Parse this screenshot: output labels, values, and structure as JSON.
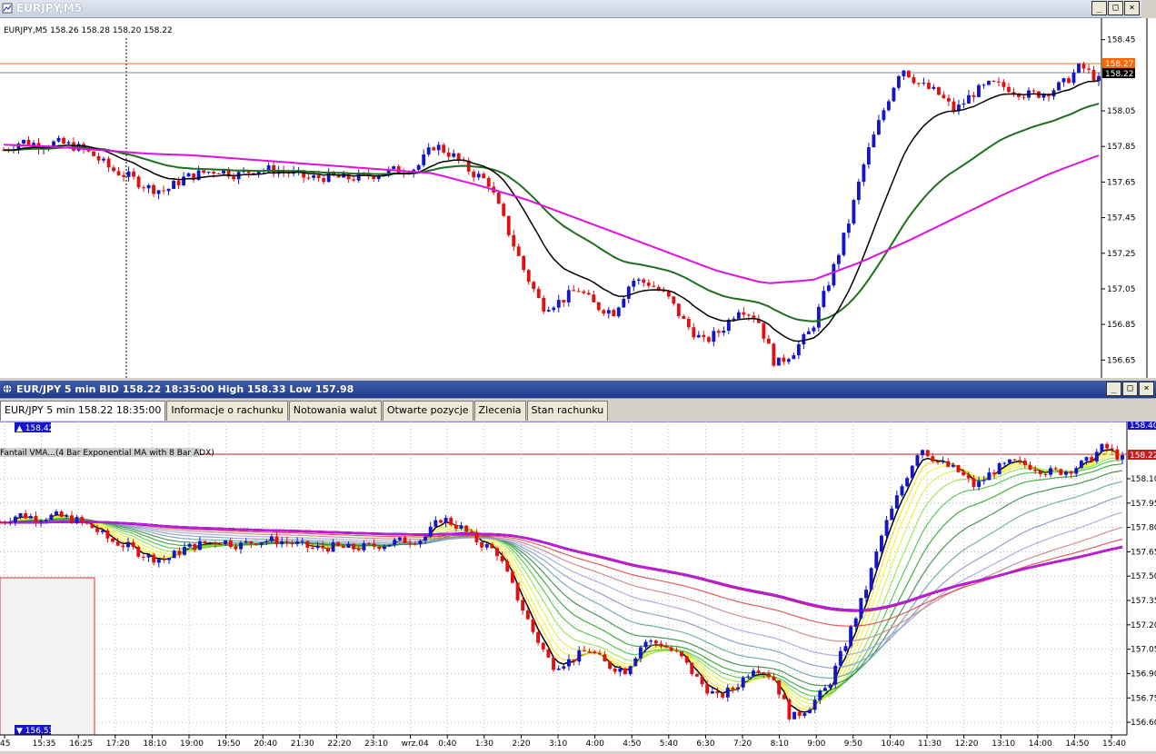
{
  "window1": {
    "title": "EURJPY,M5",
    "info": "EURJPY,M5  158.26 158.28 158.20 158.22"
  },
  "window2": {
    "title": "EUR/JPY 5 min BID 158.22 18:35:00 High 158.33 Low 157.98"
  },
  "tabs": [
    {
      "label": "EUR/JPY 5 min 158.22 18:35:00"
    },
    {
      "label": "Informacje o rachunku"
    },
    {
      "label": "Notowania walut"
    },
    {
      "label": "Otwarte pozycje"
    },
    {
      "label": "Zlecenia"
    },
    {
      "label": "Stan rachunku"
    }
  ],
  "indicator_label": "Fantail VMA...(4 Bar Exponential MA with 8 Bar ADX)",
  "chart1_yaxis": [
    "158.45",
    "158.05",
    "157.85",
    "157.65",
    "157.45",
    "157.25",
    "157.05",
    "156.85",
    "156.65"
  ],
  "chart1_price_tags": {
    "ask": "158.27",
    "bid": "158.22"
  },
  "chart2_yaxis": [
    "158.10",
    "157.95",
    "157.80",
    "157.65",
    "157.50",
    "157.35",
    "157.20",
    "157.05",
    "156.90",
    "156.75",
    "156.60"
  ],
  "chart2_price_tags": {
    "high": "158.40",
    "last": "158.22"
  },
  "chart2_markers": {
    "high": "158.42",
    "low": "156.53"
  },
  "xaxis": [
    "45",
    "15:35",
    "16:25",
    "17:20",
    "18:10",
    "19:00",
    "19:50",
    "20:40",
    "21:30",
    "22:20",
    "23:10",
    "wrz.04",
    "0:40",
    "1:30",
    "2:20",
    "3:10",
    "4:00",
    "4:50",
    "5:40",
    "6:30",
    "7:20",
    "8:10",
    "9:00",
    "9:50",
    "10:40",
    "11:30",
    "12:20",
    "13:10",
    "14:00",
    "14:50",
    "15:40"
  ],
  "colors": {
    "bull": "#1414c8",
    "bear": "#e01010",
    "ma_fast": "#000000",
    "ma_slow": "#1e6e1e",
    "ma_long": "#e010e0",
    "ask_tag": "#ff6600",
    "bid_tag": "#000000",
    "header_blue": "#1f3c88"
  },
  "chart_data": {
    "type": "candlestick",
    "price_path": [
      157.83,
      157.88,
      157.86,
      157.87,
      157.85,
      157.8,
      157.72,
      157.68,
      157.62,
      157.6,
      157.67,
      157.7,
      157.72,
      157.69,
      157.72,
      157.72,
      157.7,
      157.67,
      157.68,
      157.67,
      157.68,
      157.7,
      157.72,
      157.73,
      157.86,
      157.8,
      157.71,
      157.65,
      157.4,
      157.15,
      156.95,
      156.98,
      157.05,
      156.95,
      156.92,
      157.1,
      157.08,
      157.0,
      156.85,
      156.75,
      156.82,
      156.95,
      156.88,
      156.62,
      156.7,
      156.82,
      157.1,
      157.4,
      157.78,
      158.05,
      158.3,
      158.2,
      158.15,
      158.05,
      158.15,
      158.2,
      158.18,
      158.14,
      158.15,
      158.2,
      158.3,
      158.22
    ],
    "ma_long_path": [
      157.86,
      157.85,
      157.83,
      157.81,
      157.8,
      157.78,
      157.76,
      157.74,
      157.72,
      157.7,
      157.63,
      157.55,
      157.45,
      157.35,
      157.25,
      157.15,
      157.08,
      157.1,
      157.2,
      157.32,
      157.45,
      157.58,
      157.7,
      157.8
    ]
  }
}
